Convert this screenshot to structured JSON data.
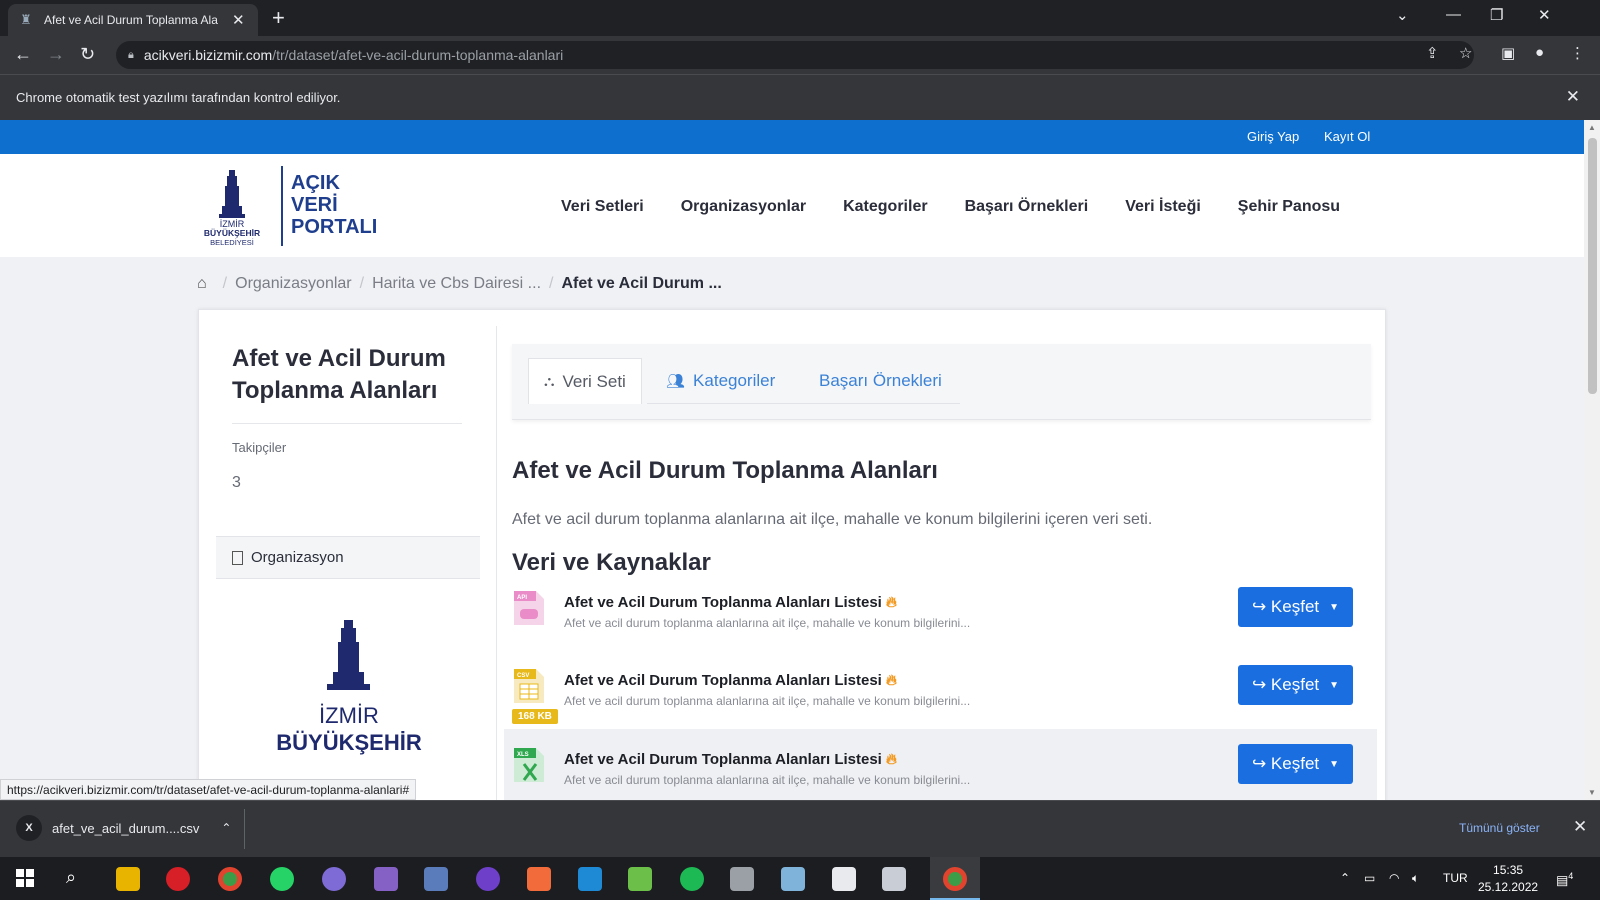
{
  "browser": {
    "tab_title": "Afet ve Acil Durum Toplanma Ala",
    "tab_close": "✕",
    "new_tab": "+",
    "url_host": "acikveri.bizizmir.com",
    "url_path": "/tr/dataset/afet-ve-acil-durum-toplanma-alanlari",
    "infobar_message": "Chrome otomatik test yazılımı tarafından kontrol ediliyor.",
    "status_url": "https://acikveri.bizizmir.com/tr/dataset/afet-ve-acil-durum-toplanma-alanlari#"
  },
  "site": {
    "top_links": {
      "login": "Giriş Yap",
      "register": "Kayıt Ol"
    },
    "logo": {
      "line1": "AÇIK",
      "line2": "VERİ",
      "line3": "PORTALI",
      "tower_line1": "İZMİR",
      "tower_line2": "BÜYÜKŞEHİR",
      "tower_line3": "BELEDİYESİ"
    },
    "nav": [
      "Veri Setleri",
      "Organizasyonlar",
      "Kategoriler",
      "Başarı Örnekleri",
      "Veri İsteği",
      "Şehir Panosu"
    ]
  },
  "breadcrumb": {
    "items": [
      "Organizasyonlar",
      "Harita ve Cbs Dairesi ...",
      "Afet ve Acil Durum ..."
    ]
  },
  "sidebar": {
    "title": "Afet ve Acil Durum Toplanma Alanları",
    "followers_label": "Takipçiler",
    "followers_value": "3",
    "org_label": "Organizasyon",
    "org_logo_line1": "İZMİR",
    "org_logo_line2": "BÜYÜKŞEHİR"
  },
  "tabs": [
    {
      "label": "Veri Seti",
      "icon": "sitemap-icon",
      "active": true
    },
    {
      "label": "Kategoriler",
      "icon": "users-icon",
      "active": false
    },
    {
      "label": "Başarı Örnekleri",
      "icon": "",
      "active": false
    }
  ],
  "dataset": {
    "heading": "Afet ve Acil Durum Toplanma Alanları",
    "description": "Afet ve acil durum toplanma alanlarına ait ilçe, mahalle ve konum bilgilerini içeren veri seti.",
    "resources_heading": "Veri ve Kaynaklar",
    "resources": [
      {
        "format": "API",
        "title": "Afet ve Acil Durum Toplanma Alanları Listesi",
        "desc": "Afet ve acil durum toplanma alanlarına ait ilçe, mahalle ve konum bilgilerini...",
        "size": "",
        "button": "Keşfet",
        "color": "#e98cc7"
      },
      {
        "format": "CSV",
        "title": "Afet ve Acil Durum Toplanma Alanları Listesi",
        "desc": "Afet ve acil durum toplanma alanlarına ait ilçe, mahalle ve konum bilgilerini...",
        "size": "168 KB",
        "button": "Keşfet",
        "color": "#e8b91a"
      },
      {
        "format": "XLS",
        "title": "Afet ve Acil Durum Toplanma Alanları Listesi",
        "desc": "Afet ve acil durum toplanma alanlarına ait ilçe, mahalle ve konum bilgilerini...",
        "size": "",
        "button": "Keşfet",
        "color": "#2fa84f"
      }
    ]
  },
  "download_bar": {
    "file_name": "afet_ve_acil_durum....csv",
    "show_all": "Tümünü göster"
  },
  "taskbar": {
    "lang": "TUR",
    "time": "15:35",
    "date": "25.12.2022",
    "notifications": "4"
  }
}
